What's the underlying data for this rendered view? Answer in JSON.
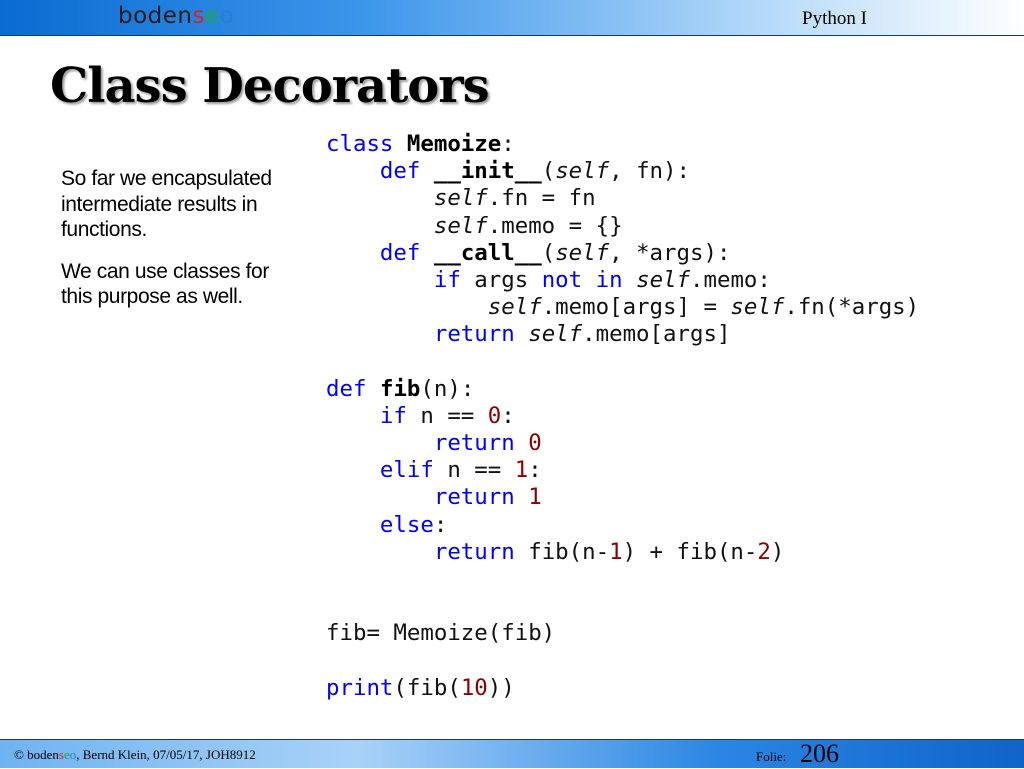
{
  "header": {
    "logo": {
      "part1": "boden",
      "part2": "s",
      "part3": "e",
      "part4": "o"
    },
    "course": "Python I"
  },
  "slide": {
    "title": "Class Decorators",
    "side_text": [
      "So far we encapsulated intermediate results in functions.",
      "We can use classes for this purpose as well."
    ],
    "code": {
      "l1": {
        "kw": "class",
        "name": "Memoize",
        "rest": ":"
      },
      "l2": {
        "kw": "def",
        "name": "__init__",
        "p1": "(",
        "self": "self",
        "p2": ", fn):"
      },
      "l3": {
        "self": "self",
        "rest": ".fn = fn"
      },
      "l4": {
        "self": "self",
        "rest": ".memo = {}"
      },
      "l5": {
        "kw": "def",
        "name": "__call__",
        "p1": "(",
        "self": "self",
        "p2": ", *args):"
      },
      "l6": {
        "kw1": "if",
        "mid1": " args ",
        "kw2": "not",
        "mid2": " ",
        "kw3": "in",
        "mid3": " ",
        "self": "self",
        "rest": ".memo:"
      },
      "l7": {
        "self1": "self",
        "mid": ".memo[args] = ",
        "self2": "self",
        "rest": ".fn(*args)"
      },
      "l8": {
        "kw": "return",
        "sp": " ",
        "self": "self",
        "rest": ".memo[args]"
      },
      "l10": {
        "kw": "def",
        "name": "fib",
        "rest": "(n):"
      },
      "l11": {
        "kw": "if",
        "mid": " n == ",
        "num": "0",
        "rest": ":"
      },
      "l12": {
        "kw": "return",
        "num": "0"
      },
      "l13": {
        "kw": "elif",
        "mid": " n == ",
        "num": "1",
        "rest": ":"
      },
      "l14": {
        "kw": "return",
        "num": "1"
      },
      "l15": {
        "kw": "else",
        "rest": ":"
      },
      "l16": {
        "kw": "return",
        "mid1": " fib(n-",
        "num1": "1",
        "mid2": ") + fib(n-",
        "num2": "2",
        "rest": ")"
      },
      "l19": {
        "text": "fib= Memoize(fib)"
      },
      "l21": {
        "kw": "print",
        "mid": "(fib(",
        "num": "10",
        "rest": "))"
      }
    }
  },
  "footer": {
    "copyright": "© ",
    "logo": {
      "part1": "boden",
      "part2": "s",
      "part3": "e",
      "part4": "o"
    },
    "info": ", Bernd Klein, 07/05/17, JOH8912",
    "folie_label": "Folie:",
    "folie_number": "206"
  },
  "colors": {
    "keyword": "#0000ff",
    "number": "#8b0000",
    "logo_red": "#d8231f",
    "logo_green": "#1fa64a",
    "logo_blue": "#2a7fd4"
  }
}
